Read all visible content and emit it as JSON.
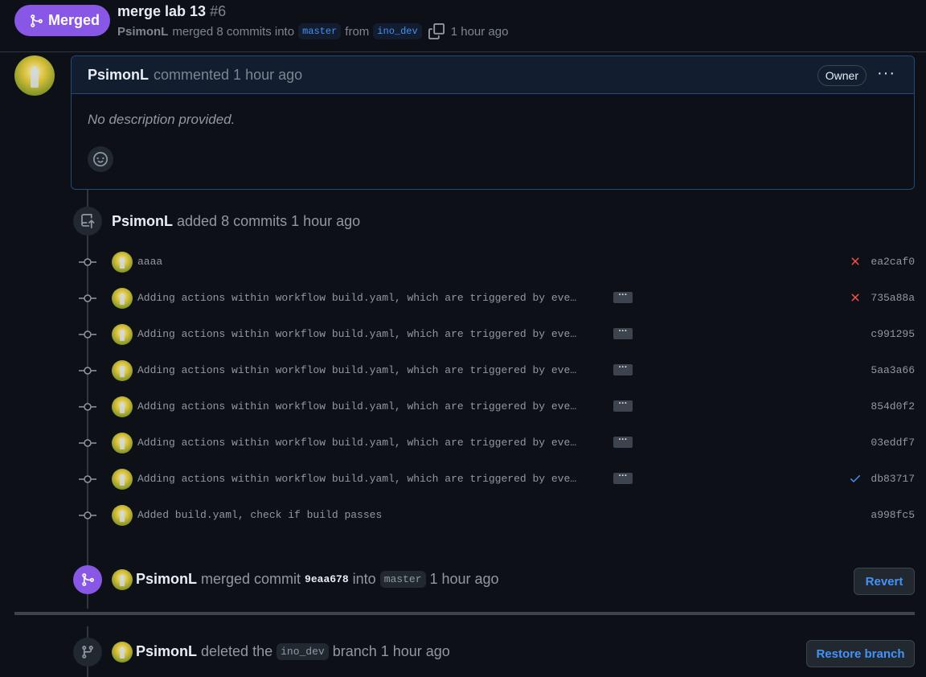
{
  "header": {
    "status_label": "Merged",
    "title": "merge lab 13",
    "number": "#6",
    "author": "PsimonL",
    "merged_text": "merged 8 commits into",
    "base_branch": "master",
    "from_text": "from",
    "head_branch": "ino_dev",
    "time": "1 hour ago"
  },
  "comment": {
    "author": "PsimonL",
    "action": "commented 1 hour ago",
    "role_badge": "Owner",
    "menu": "···",
    "body": "No description provided."
  },
  "commits_event": {
    "author": "PsimonL",
    "text": "added 8 commits 1 hour ago"
  },
  "commits": [
    {
      "message": "aaaa",
      "sha": "ea2caf0",
      "status": "failure",
      "has_more": false
    },
    {
      "message": "Adding actions within workflow build.yaml, which are triggered by eve…",
      "sha": "735a88a",
      "status": "failure",
      "has_more": true
    },
    {
      "message": "Adding actions within workflow build.yaml, which are triggered by eve…",
      "sha": "c991295",
      "status": "none",
      "has_more": true
    },
    {
      "message": "Adding actions within workflow build.yaml, which are triggered by eve…",
      "sha": "5aa3a66",
      "status": "none",
      "has_more": true
    },
    {
      "message": "Adding actions within workflow build.yaml, which are triggered by eve…",
      "sha": "854d0f2",
      "status": "none",
      "has_more": true
    },
    {
      "message": "Adding actions within workflow build.yaml, which are triggered by eve…",
      "sha": "03eddf7",
      "status": "none",
      "has_more": true
    },
    {
      "message": "Adding actions within workflow build.yaml, which are triggered by eve…",
      "sha": "db83717",
      "status": "success",
      "has_more": true
    },
    {
      "message": "Added build.yaml, check if build passes",
      "sha": "a998fc5",
      "status": "none",
      "has_more": false
    }
  ],
  "merge_event": {
    "author": "PsimonL",
    "text1": "merged commit",
    "sha": "9eaa678",
    "text2": "into",
    "branch": "master",
    "time": "1 hour ago",
    "button": "Revert"
  },
  "delete_event": {
    "author": "PsimonL",
    "text1": "deleted the",
    "branch": "ino_dev",
    "text2": "branch 1 hour ago",
    "button": "Restore branch"
  },
  "colors": {
    "merged": "#8957e5",
    "link": "#4493f8",
    "failure": "#f85149",
    "success": "#4493f8"
  },
  "icons": [
    "merge-icon",
    "copy-icon",
    "smiley-icon",
    "push-icon",
    "commit-icon",
    "x-icon",
    "check-icon",
    "branch-icon"
  ]
}
